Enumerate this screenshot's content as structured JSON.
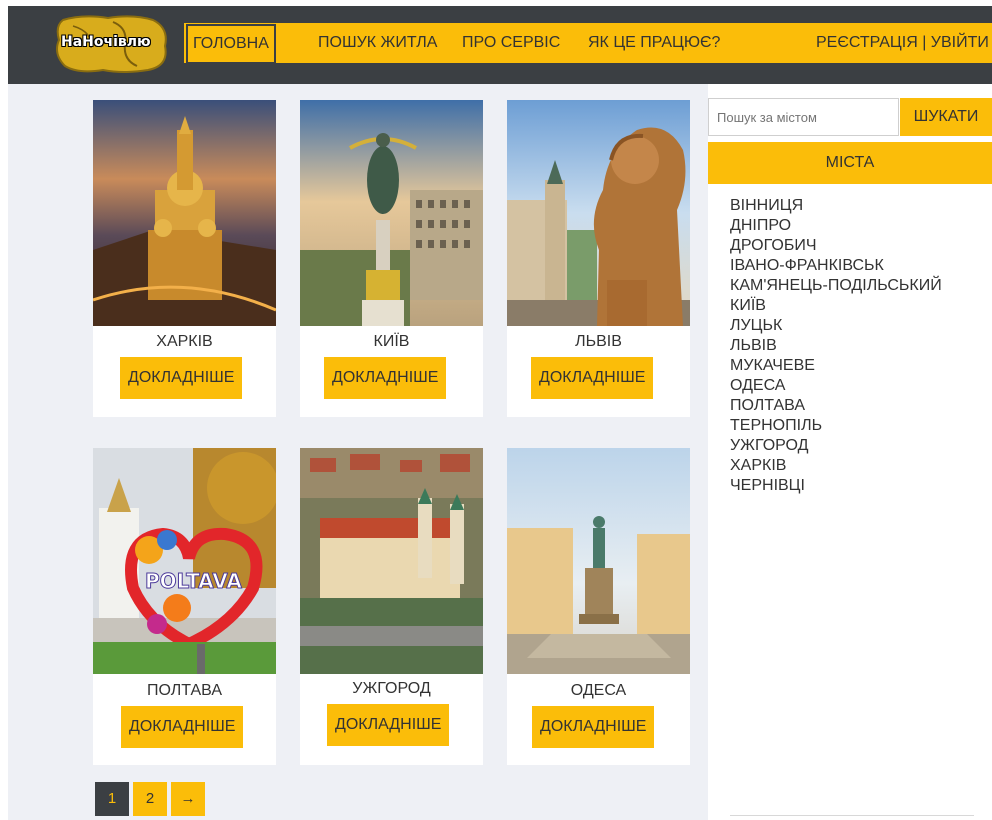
{
  "header": {
    "logo_text": "НаНочівлю",
    "nav": {
      "home": "ГОЛОВНА",
      "search": "ПОШУК ЖИТЛА",
      "about": "ПРО СЕРВІС",
      "how": "ЯК ЦЕ ПРАЦЮЄ?",
      "auth": "РЕЄСТРАЦІЯ | УВІЙТИ"
    }
  },
  "cards": [
    {
      "city": "ХАРКІВ",
      "button": "ДОКЛАДНІШЕ"
    },
    {
      "city": "КИЇВ",
      "button": "ДОКЛАДНІШЕ"
    },
    {
      "city": "ЛЬВІВ",
      "button": "ДОКЛАДНІШЕ"
    },
    {
      "city": "ПОЛТАВА",
      "button": "ДОКЛАДНІШЕ"
    },
    {
      "city": "УЖГОРОД",
      "button": "ДОКЛАДНІШЕ"
    },
    {
      "city": "ОДЕСА",
      "button": "ДОКЛАДНІШЕ"
    }
  ],
  "photo_text": {
    "poltava_sign": "POLTAVA"
  },
  "pagination": {
    "page1": "1",
    "page2": "2",
    "next": "→",
    "current_page": 1
  },
  "sidebar": {
    "search_placeholder": "Пошук за містом",
    "search_button": "ШУКАТИ",
    "cities_heading": "МІСТА",
    "cities": [
      "ВІННИЦЯ",
      "ДНІПРО",
      "ДРОГОБИЧ",
      "ІВАНО-ФРАНКІВСЬК",
      "КАМ'ЯНЕЦЬ-ПОДІЛЬСЬКИЙ",
      "КИЇВ",
      "ЛУЦЬК",
      "ЛЬВІВ",
      "МУКАЧЕВЕ",
      "ОДЕСА",
      "ПОЛТАВА",
      "ТЕРНОПІЛЬ",
      "УЖГОРОД",
      "ХАРКІВ",
      "ЧЕРНІВЦІ"
    ]
  },
  "colors": {
    "accent": "#fbbd09",
    "header_bg": "#3b3f43",
    "page_bg": "#eef0f5"
  }
}
